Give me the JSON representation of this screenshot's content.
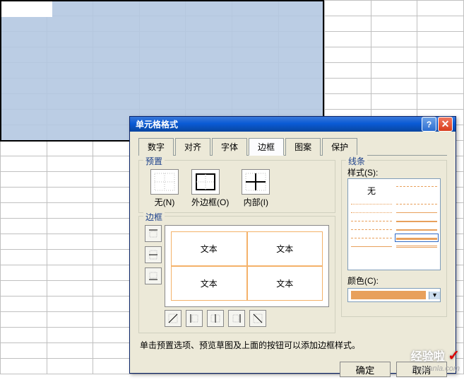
{
  "dialog": {
    "title": "单元格格式",
    "tabs": [
      "数字",
      "对齐",
      "字体",
      "边框",
      "图案",
      "保护"
    ],
    "active_tab": "边框",
    "preset_label": "预置",
    "presets": {
      "none": "无(N)",
      "outline": "外边框(O)",
      "inside": "内部(I)"
    },
    "border_label": "边框",
    "preview_text": "文本",
    "line_label": "线条",
    "style_label": "样式(S):",
    "style_none": "无",
    "color_label": "颜色(C):",
    "color_value": "#e8a05c",
    "hint": "单击预置选项、预览草图及上面的按钮可以添加边框样式。",
    "ok": "确定",
    "cancel": "取消"
  },
  "watermark": {
    "line1": "经验啦",
    "line2": "jingyanla.com"
  }
}
